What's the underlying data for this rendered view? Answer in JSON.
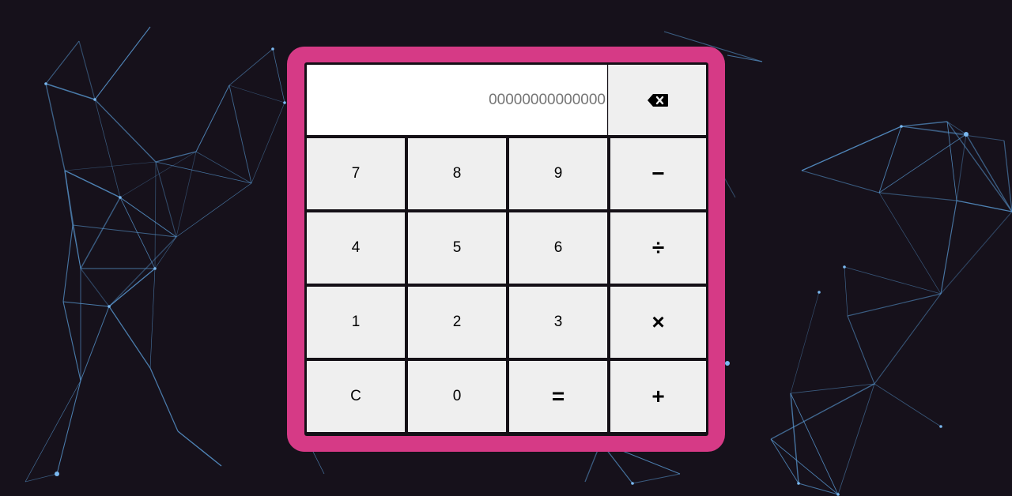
{
  "display": {
    "value": "00000000000000"
  },
  "keys": {
    "backspace_icon": "backspace-icon",
    "rows": [
      [
        {
          "label": "7",
          "name": "key-7"
        },
        {
          "label": "8",
          "name": "key-8"
        },
        {
          "label": "9",
          "name": "key-9"
        },
        {
          "label": "−",
          "name": "subtract-button",
          "op": true
        }
      ],
      [
        {
          "label": "4",
          "name": "key-4"
        },
        {
          "label": "5",
          "name": "key-5"
        },
        {
          "label": "6",
          "name": "key-6"
        },
        {
          "label": "÷",
          "name": "divide-button",
          "op": true
        }
      ],
      [
        {
          "label": "1",
          "name": "key-1"
        },
        {
          "label": "2",
          "name": "key-2"
        },
        {
          "label": "3",
          "name": "key-3"
        },
        {
          "label": "×",
          "name": "multiply-button",
          "op": true
        }
      ],
      [
        {
          "label": "C",
          "name": "clear-button"
        },
        {
          "label": "0",
          "name": "key-0"
        },
        {
          "label": "=",
          "name": "equals-button",
          "op": true
        },
        {
          "label": "+",
          "name": "add-button",
          "op": true
        }
      ]
    ]
  },
  "colors": {
    "frame": "#d63a86",
    "background": "#16111b",
    "key": "#efefef",
    "network_line": "#5a9bd5",
    "network_node": "#7ab8f0"
  }
}
